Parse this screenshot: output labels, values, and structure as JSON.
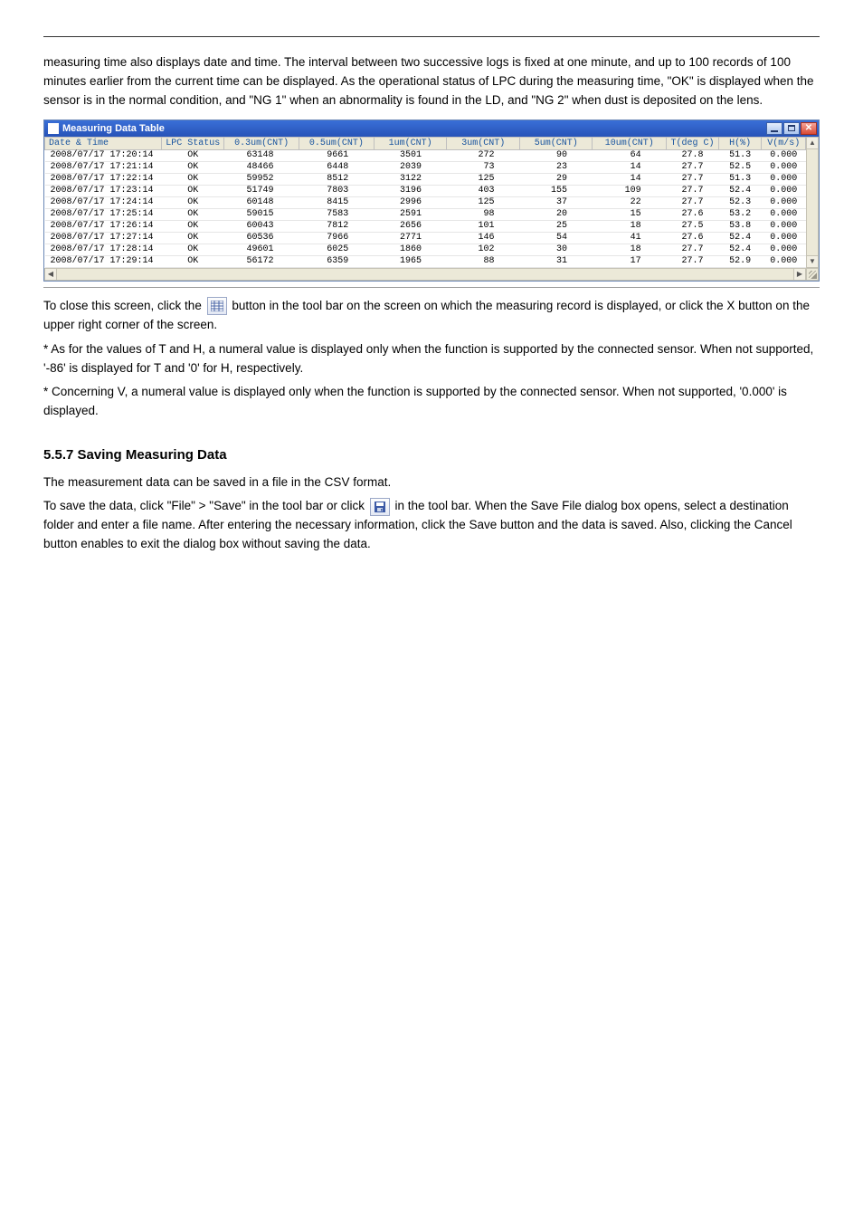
{
  "intro_paragraph": "measuring time also displays date and time. The interval between two successive logs is fixed at one minute, and up to 100 records of 100 minutes earlier from the current time can be displayed. As the operational status of LPC during the measuring time, \"OK\" is displayed when the sensor is in the normal condition, and \"NG 1\" when an abnormality is found in the LD, and \"NG 2\" when dust is deposited on the lens.",
  "window_title": "Measuring Data Table",
  "columns": [
    "Date & Time",
    "LPC Status",
    "0.3um(CNT)",
    "0.5um(CNT)",
    "1um(CNT)",
    "3um(CNT)",
    "5um(CNT)",
    "10um(CNT)",
    "T(deg C)",
    "H(%)",
    "V(m/s)"
  ],
  "rows": [
    {
      "dt": "2008/07/17 17:20:14",
      "st": "OK",
      "c03": "63148",
      "c05": "9661",
      "c1": "3501",
      "c3": "272",
      "c5": "90",
      "c10": "64",
      "t": "27.8",
      "h": "51.3",
      "v": "0.000"
    },
    {
      "dt": "2008/07/17 17:21:14",
      "st": "OK",
      "c03": "48466",
      "c05": "6448",
      "c1": "2039",
      "c3": "73",
      "c5": "23",
      "c10": "14",
      "t": "27.7",
      "h": "52.5",
      "v": "0.000"
    },
    {
      "dt": "2008/07/17 17:22:14",
      "st": "OK",
      "c03": "59952",
      "c05": "8512",
      "c1": "3122",
      "c3": "125",
      "c5": "29",
      "c10": "14",
      "t": "27.7",
      "h": "51.3",
      "v": "0.000"
    },
    {
      "dt": "2008/07/17 17:23:14",
      "st": "OK",
      "c03": "51749",
      "c05": "7803",
      "c1": "3196",
      "c3": "403",
      "c5": "155",
      "c10": "109",
      "t": "27.7",
      "h": "52.4",
      "v": "0.000"
    },
    {
      "dt": "2008/07/17 17:24:14",
      "st": "OK",
      "c03": "60148",
      "c05": "8415",
      "c1": "2996",
      "c3": "125",
      "c5": "37",
      "c10": "22",
      "t": "27.7",
      "h": "52.3",
      "v": "0.000"
    },
    {
      "dt": "2008/07/17 17:25:14",
      "st": "OK",
      "c03": "59015",
      "c05": "7583",
      "c1": "2591",
      "c3": "98",
      "c5": "20",
      "c10": "15",
      "t": "27.6",
      "h": "53.2",
      "v": "0.000"
    },
    {
      "dt": "2008/07/17 17:26:14",
      "st": "OK",
      "c03": "60043",
      "c05": "7812",
      "c1": "2656",
      "c3": "101",
      "c5": "25",
      "c10": "18",
      "t": "27.5",
      "h": "53.8",
      "v": "0.000"
    },
    {
      "dt": "2008/07/17 17:27:14",
      "st": "OK",
      "c03": "60536",
      "c05": "7966",
      "c1": "2771",
      "c3": "146",
      "c5": "54",
      "c10": "41",
      "t": "27.6",
      "h": "52.4",
      "v": "0.000"
    },
    {
      "dt": "2008/07/17 17:28:14",
      "st": "OK",
      "c03": "49601",
      "c05": "6025",
      "c1": "1860",
      "c3": "102",
      "c5": "30",
      "c10": "18",
      "t": "27.7",
      "h": "52.4",
      "v": "0.000"
    },
    {
      "dt": "2008/07/17 17:29:14",
      "st": "OK",
      "c03": "56172",
      "c05": "6359",
      "c1": "1965",
      "c3": "88",
      "c5": "31",
      "c10": "17",
      "t": "27.7",
      "h": "52.9",
      "v": "0.000"
    }
  ],
  "after_1_prefix": "To close this screen, click the ",
  "after_1_suffix": " button in the tool bar on the screen on which the measuring record is displayed, or click the X button on the upper right corner of the screen.",
  "after_2": "* As for the values of T and H, a numeral value is displayed only when the function is supported by the connected sensor. When not supported, '-86' is displayed for T and '0' for H, respectively.",
  "after_3": "* Concerning V, a numeral value is displayed only when the function is supported by the connected sensor. When not supported, '0.000' is displayed.",
  "save_heading": "5.5.7 Saving Measuring Data",
  "save_body_1": "The measurement data can be saved in a file in the CSV format.",
  "save_body_2_prefix": "To save the data, click \"File\" > \"Save\" in the tool bar or click ",
  "save_body_2_suffix": " in the tool bar. When the Save File dialog box opens, select a destination folder and enter a file name. After entering the necessary information, click the Save button and the data is saved. Also, clicking the Cancel button enables to exit the dialog box without saving the data."
}
